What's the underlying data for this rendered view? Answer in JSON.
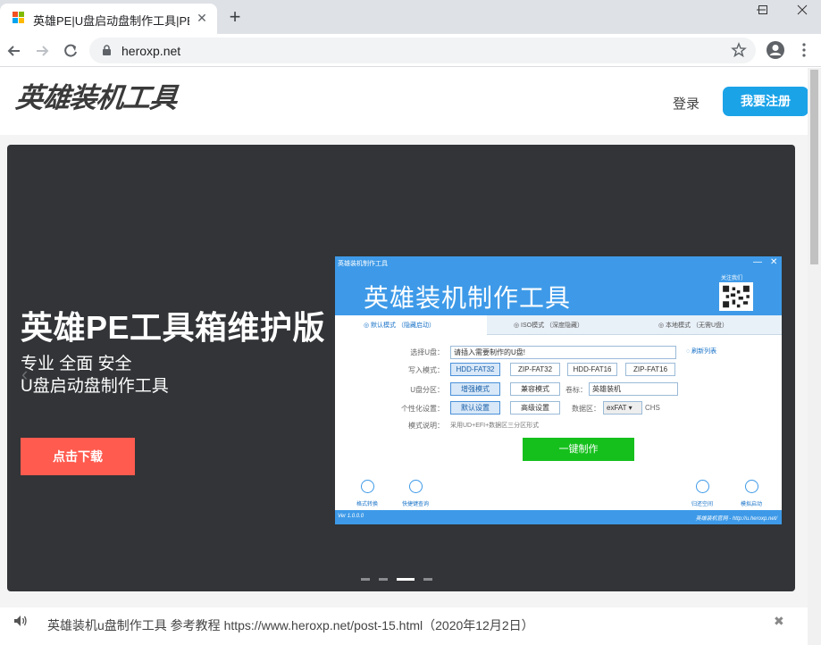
{
  "browser": {
    "tab_title": "英雄PE|U盘启动盘制作工具|PE工",
    "url": "heroxp.net",
    "tab_close": "✕",
    "new_tab": "+"
  },
  "site": {
    "logo_text": "英雄装机工具",
    "login": "登录",
    "register": "我要注册"
  },
  "banner": {
    "title": "英雄PE工具箱维护版",
    "subtitle_line1": "专业 全面 安全",
    "subtitle_line2": "U盘启动盘制作工具",
    "download_button": "点击下载",
    "prev_arrow": "‹",
    "next_arrow": "›",
    "dots_count": 4,
    "active_dot": 3
  },
  "app": {
    "window_title": "英雄装机制作工具",
    "heading": "英雄装机制作工具",
    "qr_label": "关注我们",
    "tabs": [
      {
        "label": "◎ 默认模式 （隐藏启动）",
        "active": true
      },
      {
        "label": "◎ ISO模式 （深度隐藏）",
        "active": false
      },
      {
        "label": "◎ 本地模式 （无需U盘）",
        "active": false
      }
    ],
    "usb_label": "选择U盘：",
    "usb_value": "请插入需要制作的U盘!",
    "refresh": "◌ 刷新列表",
    "write_label": "写入模式：",
    "write_modes": [
      "HDD-FAT32",
      "ZIP-FAT32",
      "HDD-FAT16",
      "ZIP-FAT16"
    ],
    "partition_label": "U盘分区：",
    "partition_modes": [
      "增强模式",
      "兼容模式"
    ],
    "volume_label": "卷标：",
    "volume_value": "英雄装机",
    "personal_label": "个性化设置：",
    "personal_modes": [
      "默认设置",
      "高级设置"
    ],
    "data_label": "数据区：",
    "data_value": "exFAT ▾",
    "chs": "CHS",
    "mode_desc_label": "模式说明：",
    "mode_desc": "采用UD+EFI+数据区三分区形式",
    "make_button": "一键制作",
    "bottom_icons": [
      "格式转换",
      "快捷键查询",
      "归还空间",
      "模拟启动"
    ],
    "footer_left": "Ver 1.0.0.0",
    "footer_right": "英雄装机官网 - http://u.heroxp.net/"
  },
  "notice": {
    "text": "英雄装机u盘制作工具 参考教程  https://www.heroxp.net/post-15.html（2020年12月2日）",
    "close": "✖"
  }
}
